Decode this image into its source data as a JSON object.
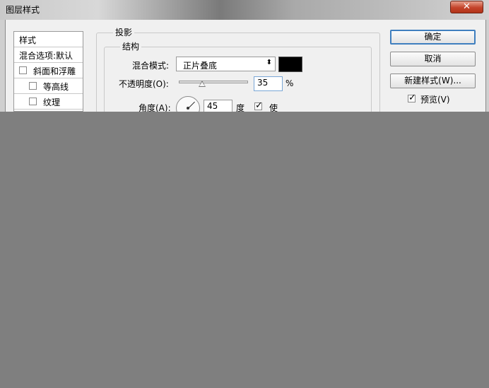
{
  "window": {
    "title": "图层样式",
    "close_label": "✕"
  },
  "styles_list": {
    "items": [
      {
        "label": "样式",
        "checkbox": false
      },
      {
        "label": "混合选项:默认",
        "checkbox": false
      },
      {
        "label": "斜面和浮雕",
        "checkbox": true,
        "checked": false
      },
      {
        "label": "等高线",
        "checkbox": true,
        "checked": false
      },
      {
        "label": "纹理",
        "checkbox": true,
        "checked": false
      }
    ]
  },
  "drop_shadow": {
    "section_title": "投影",
    "structure_title": "结构",
    "blend_mode_label": "混合模式:",
    "blend_mode_value": "正片叠底",
    "shadow_color": "#000000",
    "opacity_label": "不透明度(O):",
    "opacity_value": "35",
    "opacity_unit": "%",
    "opacity_fraction": 0.35,
    "angle_label": "角度(A):",
    "angle_value": "45",
    "angle_unit": "度",
    "global_light_label": "使",
    "global_light_checked": true
  },
  "buttons": {
    "ok": "确定",
    "cancel": "取消",
    "new_style": "新建样式(W)...",
    "preview_label": "预览(V)",
    "preview_checked": true
  },
  "colors": {
    "accent": "#3f7fbf",
    "dialog_bg": "#f0f0f0",
    "overlay": "#7f7f7f"
  }
}
